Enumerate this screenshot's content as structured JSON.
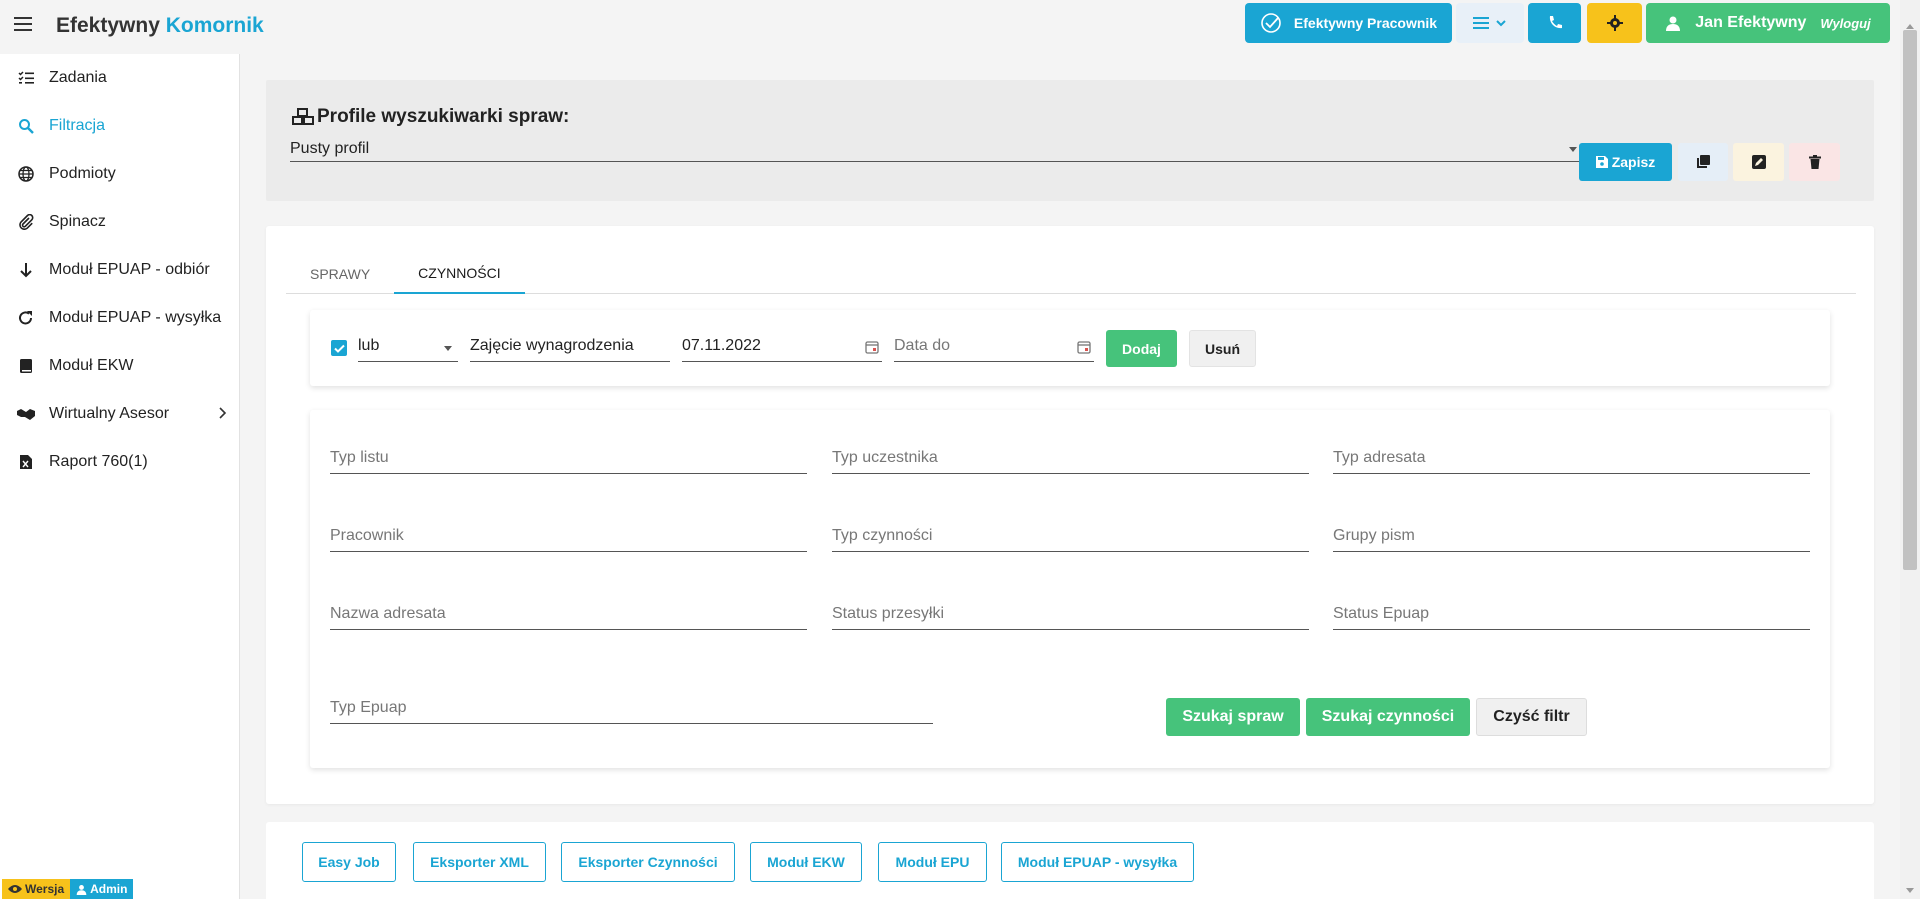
{
  "header": {
    "brand_main": "Efektywny",
    "brand_accent": "Komornik",
    "pracownik_label": "Efektywny Pracownik",
    "user_name": "Jan Efektywny",
    "logout_label": "Wyloguj"
  },
  "sidebar": {
    "items": [
      {
        "label": "Zadania",
        "icon": "list-check-icon"
      },
      {
        "label": "Filtracja",
        "icon": "search-icon"
      },
      {
        "label": "Podmioty",
        "icon": "globe-icon"
      },
      {
        "label": "Spinacz",
        "icon": "paperclip-icon"
      },
      {
        "label": "Moduł EPUAP - odbiór",
        "icon": "arrow-down-icon"
      },
      {
        "label": "Moduł EPUAP - wysyłka",
        "icon": "redo-icon"
      },
      {
        "label": "Moduł EKW",
        "icon": "book-icon"
      },
      {
        "label": "Wirtualny Asesor",
        "icon": "handshake-icon"
      },
      {
        "label": "Raport 760(1)",
        "icon": "excel-file-icon"
      }
    ],
    "badge_wersja": "Wersja",
    "badge_admin": "Admin"
  },
  "profile": {
    "title": "Profile wyszukiwarki spraw:",
    "selected": "Pusty profil",
    "save_label": "Zapisz"
  },
  "tabs": [
    {
      "label": "SPRAWY"
    },
    {
      "label": "CZYNNOŚCI"
    }
  ],
  "filter_row": {
    "operator": "lub",
    "type": "Zajęcie wynagrodzenia",
    "date_from": "07.11.2022",
    "date_to_placeholder": "Data do",
    "add_label": "Dodaj",
    "remove_label": "Usuń"
  },
  "fields": {
    "typ_listu": "Typ listu",
    "typ_uczestnika": "Typ uczestnika",
    "typ_adresata": "Typ adresata",
    "pracownik": "Pracownik",
    "typ_czynnosci": "Typ czynności",
    "grupy_pism": "Grupy pism",
    "nazwa_adresata": "Nazwa adresata",
    "status_przesylki": "Status przesyłki",
    "status_epuap": "Status Epuap",
    "typ_epuap": "Typ Epuap"
  },
  "actions": {
    "search_cases": "Szukaj spraw",
    "search_actions": "Szukaj czynności",
    "clear_filter": "Czyść filtr"
  },
  "modules": [
    {
      "label": "Easy Job"
    },
    {
      "label": "Eksporter XML"
    },
    {
      "label": "Eksporter Czynności"
    },
    {
      "label": "Moduł EKW"
    },
    {
      "label": "Moduł EPU"
    },
    {
      "label": "Moduł EPUAP - wysyłka"
    }
  ],
  "colors": {
    "accent": "#1aa5d3",
    "success": "#46c37b",
    "warning": "#f7c21b"
  }
}
